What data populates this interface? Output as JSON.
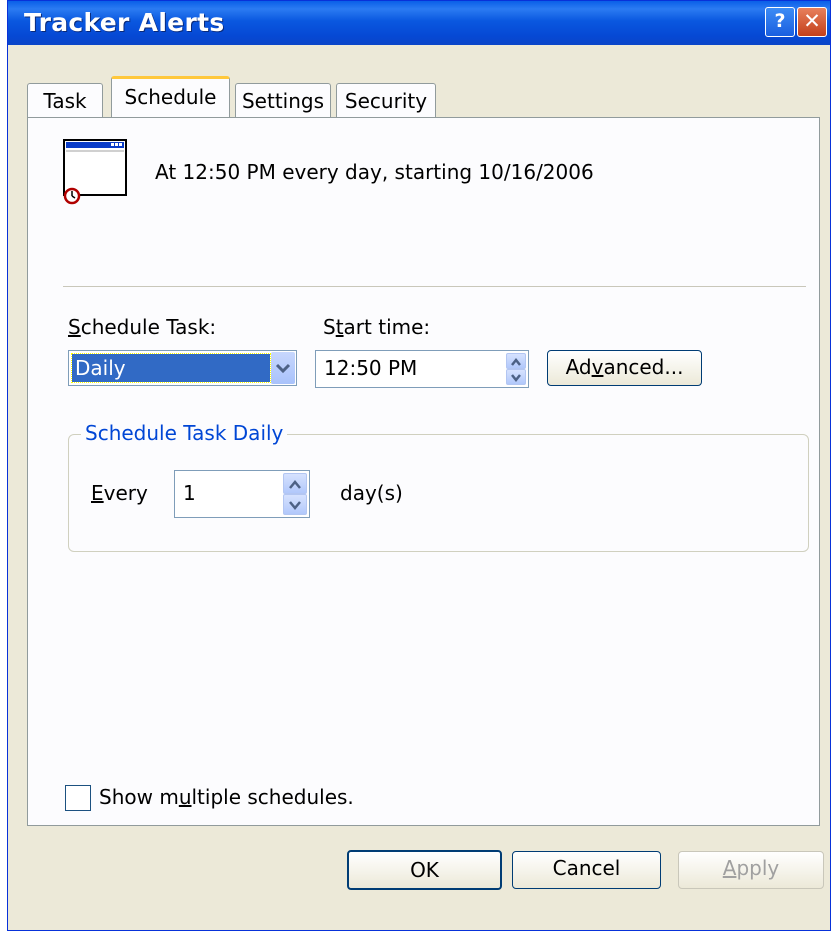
{
  "window": {
    "title": "Tracker Alerts"
  },
  "titlebar_buttons": {
    "help": "?",
    "close": "✕"
  },
  "tabs": [
    {
      "label": "Task"
    },
    {
      "label": "Schedule"
    },
    {
      "label": "Settings"
    },
    {
      "label": "Security"
    }
  ],
  "summary": "At 12:50 PM every day, starting 10/16/2006",
  "schedule_task": {
    "label_first": "S",
    "label_rest": "chedule Task:",
    "value": "Daily"
  },
  "start_time": {
    "label_a": "S",
    "label_u": "t",
    "label_rest": "art time:",
    "value": "12:50 PM"
  },
  "advanced_button": {
    "a": "Ad",
    "u": "v",
    "rest": "anced..."
  },
  "group": {
    "title": "Schedule Task Daily",
    "every_u": "E",
    "every_rest": "very",
    "every_value": "1",
    "unit": "day(s)"
  },
  "show_multiple": {
    "a": "Show m",
    "u": "u",
    "rest": "ltiple schedules."
  },
  "buttons": {
    "ok": "OK",
    "cancel": "Cancel",
    "apply_u": "A",
    "apply_rest": "pply"
  },
  "colors": {
    "titlebar": "#0a58e0",
    "selection": "#316ac5",
    "group_title": "#0046d5",
    "tab_highlight": "#ffc83c"
  }
}
